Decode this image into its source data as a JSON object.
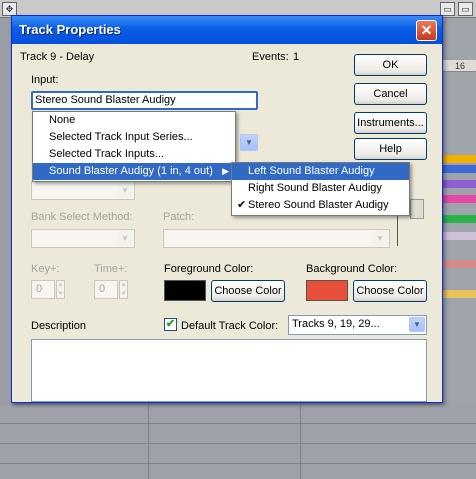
{
  "background": {
    "ruler_mark": "16",
    "toolbar_icons": [
      "four-arrows-icon",
      "window-icon",
      "window-icon",
      "window-icon"
    ],
    "track_strip_colors": [
      "#f0b000",
      "#3c6ad8",
      "#8c5ed0",
      "#e24aa6",
      "#2cb04a",
      "#cfc0d8",
      "#d58a8a",
      "#e8c25a"
    ]
  },
  "dialog": {
    "title": "Track Properties",
    "close_symbol": "✕",
    "track_name": "Track 9 - Delay",
    "events_label": "Events:",
    "events_value": "1",
    "input_label": "Input:",
    "input_value": "Stereo Sound Blaster Audigy",
    "bank_select_label": "Bank Select Method:",
    "patch_label": "Patch:",
    "key_label": "Key+:",
    "key_value": "0",
    "time_label": "Time+:",
    "time_value": "0",
    "foreground_label": "Foreground Color:",
    "foreground_color": "#000000",
    "foreground_button": "Choose Color",
    "background_label": "Background Color:",
    "background_color": "#e8503a",
    "background_button": "Choose Color",
    "description_label": "Description",
    "default_color_label": "Default Track Color:",
    "default_color_checked": true,
    "tracks_select_value": "Tracks 9, 19, 29...",
    "buttons": {
      "ok": "OK",
      "cancel": "Cancel",
      "instruments": "Instruments...",
      "help": "Help"
    }
  },
  "input_menu": {
    "items": [
      "None",
      "Selected Track Input Series...",
      "Selected Track Inputs...",
      "Sound Blaster Audigy (1 in, 4 out)"
    ],
    "selected_index": 3
  },
  "sub_menu": {
    "items": [
      "Left Sound Blaster Audigy",
      "Right Sound Blaster Audigy",
      "Stereo Sound Blaster Audigy"
    ],
    "highlighted_index": 0,
    "checked_index": 2
  }
}
